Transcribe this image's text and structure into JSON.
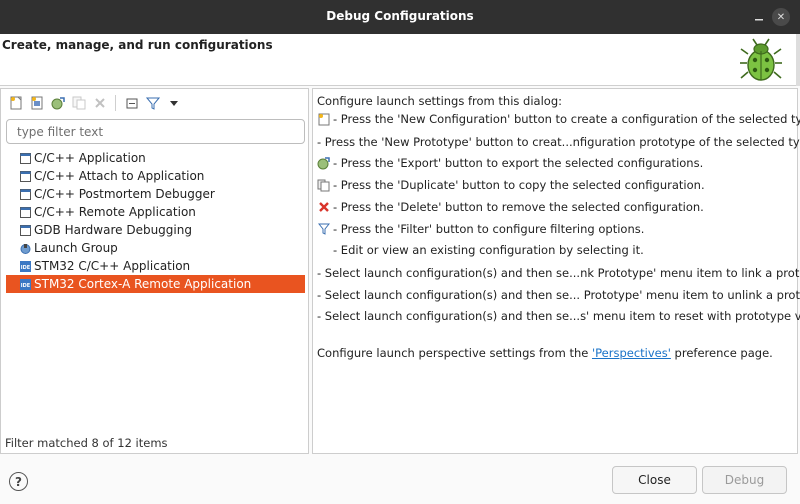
{
  "window": {
    "title": "Debug Configurations"
  },
  "header": {
    "heading": "Create, manage, and run configurations"
  },
  "left": {
    "filter_placeholder": "type filter text",
    "tree": [
      {
        "label": "C/C++ Application",
        "icon": "c-app-icon"
      },
      {
        "label": "C/C++ Attach to Application",
        "icon": "c-app-icon"
      },
      {
        "label": "C/C++ Postmortem Debugger",
        "icon": "c-app-icon"
      },
      {
        "label": "C/C++ Remote Application",
        "icon": "c-app-icon"
      },
      {
        "label": "GDB Hardware Debugging",
        "icon": "c-app-icon"
      },
      {
        "label": "Launch Group",
        "icon": "launch-group-icon"
      },
      {
        "label": "STM32 C/C++ Application",
        "icon": "ide-icon"
      },
      {
        "label": "STM32 Cortex-A Remote Application",
        "icon": "ide-icon",
        "selected": true
      }
    ],
    "status": "Filter matched 8 of 12 items"
  },
  "right": {
    "intro": "Configure launch settings from this dialog:",
    "lines": [
      "- Press the 'New Configuration' button to create a configuration of the selected type.",
      "- Press the 'New Prototype' button to creat...nfiguration prototype of the selected type.",
      "- Press the 'Export' button to export the selected configurations.",
      "- Press the 'Duplicate' button to copy the selected configuration.",
      "- Press the 'Delete' button to remove the selected configuration.",
      "- Press the 'Filter' button to configure filtering options.",
      "- Edit or view an existing configuration by selecting it.",
      "- Select launch configuration(s) and then se...nk Prototype' menu item to link a prototype.",
      "- Select launch configuration(s) and then se... Prototype' menu item to unlink a prototype.",
      "- Select launch configuration(s) and then se...s' menu item to reset with prototype values."
    ],
    "perspective_prefix": "Configure launch perspective settings from the ",
    "perspective_link": "'Perspectives'",
    "perspective_suffix": " preference page."
  },
  "footer": {
    "close_label": "Close",
    "debug_label": "Debug",
    "help_label": "?"
  },
  "colors": {
    "selection": "#e95420",
    "titlebar": "#303030",
    "link": "#1a73c8"
  }
}
